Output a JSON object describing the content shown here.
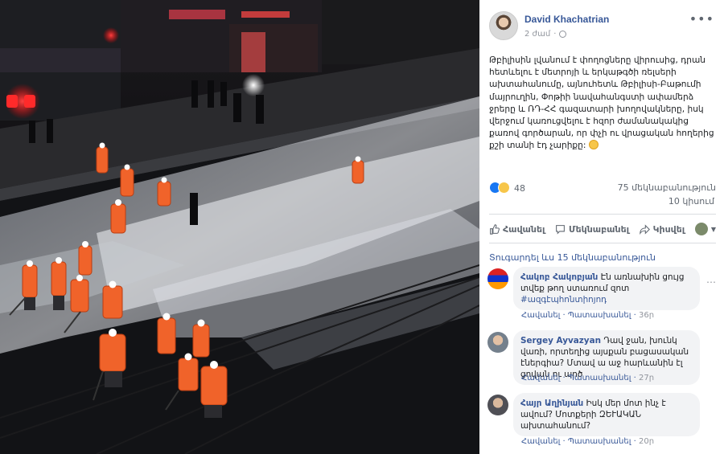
{
  "post": {
    "author": "David Khachatrian",
    "time": "2 ժամ",
    "more": "•••",
    "text": "Թբիլիսին լվանում է փողոցները վիրուսից, դրան հետևելու է մետրոյի և երկաթգծի ռելսերի ախտահանումը, այնուհետև Թբիլիսի-Բաթումի մայրուղին, Փոթիի նավահանգստի ափամերձ ջրերը և ՌԴ-ՀՀ գազատարի խողովակները, իսկ վերջում կառուցվելու է հզոր ժամանակակից քառով գործարան, որ փչի ու վրացական հողերից քշի տանի էդ չարիքը:",
    "reactions_count": "48",
    "comments_count": "75 մեկնաբանություն",
    "shares_count": "10 կիսում"
  },
  "actions": {
    "like": "Հավանել",
    "comment": "Մեկնաբանել",
    "share": "Կիսվել"
  },
  "replies_link": "Տուգարդել ևս 15 մեկնաբանություն",
  "comments": [
    {
      "name": "Հակոբ Հակոբյան",
      "text": "Էն առնախին ցույց տվեք թող ստառում զոտ",
      "tag": "#ազգէպհոնտիոյոդ",
      "like": "Հավանել",
      "reply": "Պատասխանել",
      "time": "36ր"
    },
    {
      "name": "Sergey Ayvazyan",
      "text": "Դավ ջան, խունկ վառի, որտեղից այսքան բացասական էներգիա? Մտավ ա աջ հարևանին էլ ցովան ու պրծ",
      "like": "Հավանել",
      "reply": "Պատասխանել",
      "time": "27ր"
    },
    {
      "name": "Հայր Աղինյան",
      "text": "Իսկ մեր մոտ ինչ է ավում? Մոտքերի ԶԵՒԱԿԱՆ ախտահանում?",
      "like": "Հավանել",
      "reply": "Պատասխանել",
      "time": "20ր"
    }
  ],
  "colors": {
    "link": "#385898",
    "worker_suit": "#f0632a",
    "foam": "#e6e8ee",
    "red_light": "#ff2a2a"
  }
}
